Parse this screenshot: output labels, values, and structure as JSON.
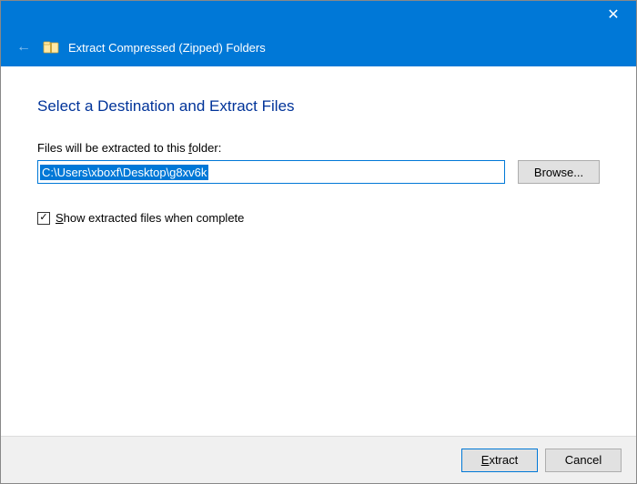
{
  "titlebar": {
    "close_glyph": "✕"
  },
  "navbar": {
    "back_glyph": "←",
    "title": "Extract Compressed (Zipped) Folders"
  },
  "content": {
    "heading": "Select a Destination and Extract Files",
    "field_label_pre": "Files will be extracted to this ",
    "field_label_underline": "f",
    "field_label_post": "older:",
    "path_value": "C:\\Users\\xboxf\\Desktop\\g8xv6k",
    "browse_label": "Browse...",
    "checkbox_checked_glyph": "✓",
    "checkbox_label_underline": "S",
    "checkbox_label_post": "how extracted files when complete"
  },
  "footer": {
    "extract_underline": "E",
    "extract_post": "xtract",
    "cancel_label": "Cancel"
  }
}
